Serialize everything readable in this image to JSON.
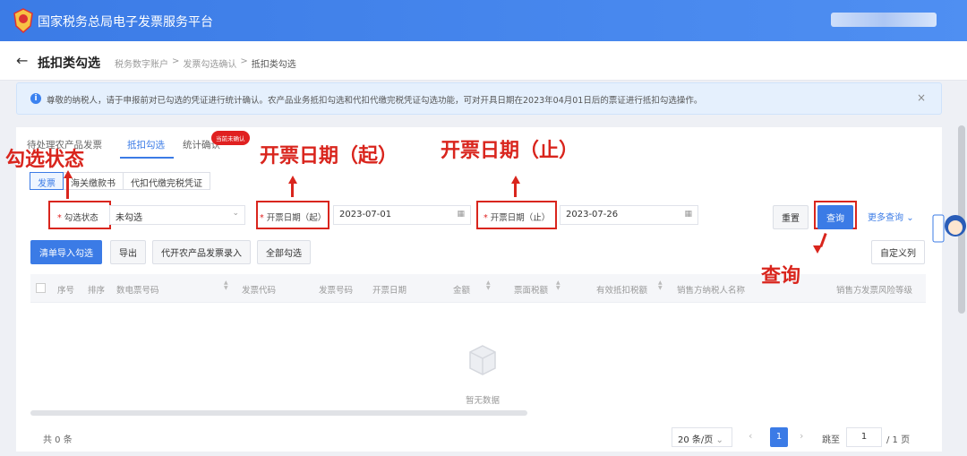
{
  "header": {
    "app_title": "国家税务总局电子发票服务平台"
  },
  "subheader": {
    "title": "抵扣类勾选",
    "breadcrumb": [
      "税务数字账户",
      ">",
      "发票勾选确认",
      ">",
      "抵扣类勾选"
    ]
  },
  "notice": {
    "text": "尊敬的纳税人，请于申报前对已勾选的凭证进行统计确认。农产品业务抵扣勾选和代扣代缴完税凭证勾选功能，可对开具日期在2023年04月01日后的票证进行抵扣勾选操作。",
    "close": "×"
  },
  "tabs": [
    {
      "label": "待处理农产品发票",
      "active": false
    },
    {
      "label": "抵扣勾选",
      "active": true
    },
    {
      "label": "统计确认",
      "active": false
    }
  ],
  "tab_badge": "当前未确认",
  "segments": [
    {
      "label": "发票",
      "active": true
    },
    {
      "label": "海关缴款书",
      "active": false
    },
    {
      "label": "代扣代缴完税凭证",
      "active": false
    }
  ],
  "filters": {
    "status_label": "勾选状态",
    "status_value": "未勾选",
    "start_label": "开票日期（起）",
    "start_value": "2023-07-01",
    "end_label": "开票日期（止）",
    "end_value": "2023-07-26",
    "required_mark": "*"
  },
  "buttons": {
    "reset": "重置",
    "query": "查询",
    "more_query": "更多查询",
    "import_select": "清单导入勾选",
    "export": "导出",
    "agri_entry": "代开农产品发票录入",
    "select_all": "全部勾选",
    "custom_columns": "自定义列"
  },
  "table": {
    "columns": [
      "序号",
      "排序",
      "数电票号码",
      "发票代码",
      "发票号码",
      "开票日期",
      "金额",
      "票面税额",
      "有效抵扣税额",
      "销售方纳税人名称",
      "销售方",
      "发票风险等级"
    ],
    "empty_text": "暂无数据"
  },
  "pagination": {
    "total": "共 0 条",
    "page_size": "20 条/页",
    "current_page": "1",
    "jump_label": "跳至",
    "jump_value": "1",
    "total_pages": "/ 1 页"
  },
  "annotations": {
    "status": "勾选状态",
    "start_date": "开票日期（起）",
    "end_date": "开票日期（止）",
    "query": "查询"
  },
  "colors": {
    "brand": "#3b7be6",
    "annotation": "#d9251d"
  }
}
